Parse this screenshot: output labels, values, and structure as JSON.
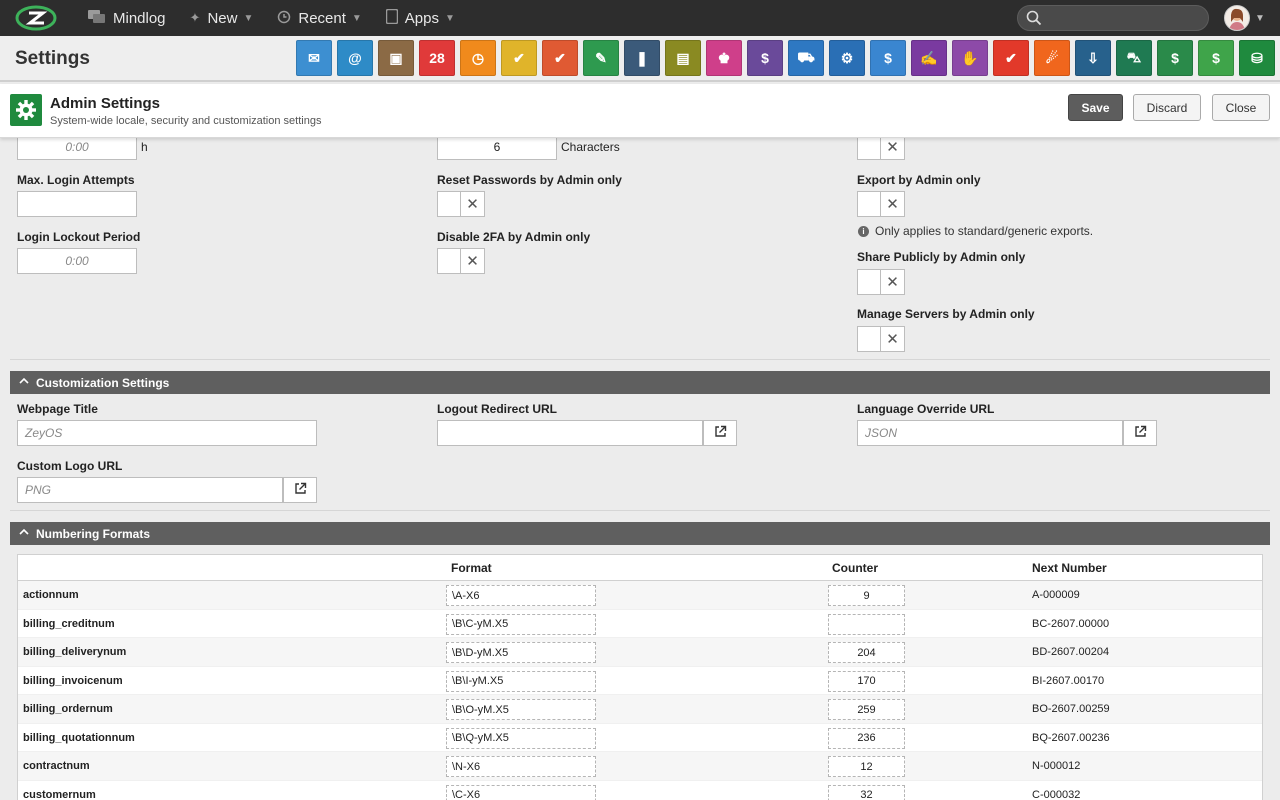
{
  "nav": {
    "mindlog": "Mindlog",
    "new": "New",
    "recent": "Recent",
    "apps": "Apps",
    "search_placeholder": ""
  },
  "settings": {
    "title": "Settings"
  },
  "app_icons": [
    {
      "name": "messages-icon",
      "color": "#3d8fd1",
      "glyph": "✉"
    },
    {
      "name": "email-accounts-icon",
      "color": "#2e8bc7",
      "glyph": "@"
    },
    {
      "name": "contacts-icon",
      "color": "#8b6a45",
      "glyph": "▣"
    },
    {
      "name": "calendar-icon",
      "color": "#e03a3a",
      "glyph": "28"
    },
    {
      "name": "timer-icon",
      "color": "#f08a1c",
      "glyph": "◷"
    },
    {
      "name": "tasks-icon",
      "color": "#e0b42a",
      "glyph": "✔"
    },
    {
      "name": "projects-icon",
      "color": "#e05a33",
      "glyph": "✔"
    },
    {
      "name": "notes-icon",
      "color": "#2e9a4f",
      "glyph": "✎"
    },
    {
      "name": "bookmarks-icon",
      "color": "#3b5a7a",
      "glyph": "❚"
    },
    {
      "name": "documents-icon",
      "color": "#8a8a22",
      "glyph": "▤"
    },
    {
      "name": "campaigns-icon",
      "color": "#cf3f8a",
      "glyph": "♚"
    },
    {
      "name": "finance-icon",
      "color": "#6a4a9a",
      "glyph": "$"
    },
    {
      "name": "delivery-icon",
      "color": "#2e78c2",
      "glyph": "⛟"
    },
    {
      "name": "support-icon",
      "color": "#2a6fb5",
      "glyph": "⚙"
    },
    {
      "name": "money-icon",
      "color": "#3a86d0",
      "glyph": "$"
    },
    {
      "name": "contracts-icon",
      "color": "#7a3aa0",
      "glyph": "✍"
    },
    {
      "name": "deals-icon",
      "color": "#8d4aa8",
      "glyph": "✋"
    },
    {
      "name": "pdf-icon",
      "color": "#e2392a",
      "glyph": "✔"
    },
    {
      "name": "broadcast-icon",
      "color": "#f0661d",
      "glyph": "☄"
    },
    {
      "name": "download-icon",
      "color": "#27618c",
      "glyph": "⇩"
    },
    {
      "name": "cart-icon",
      "color": "#1f7a52",
      "glyph": "⛍"
    },
    {
      "name": "cash-icon",
      "color": "#2a8a4a",
      "glyph": "$"
    },
    {
      "name": "price-tag-icon",
      "color": "#3fa44a",
      "glyph": "$"
    },
    {
      "name": "database-icon",
      "color": "#1f8a3e",
      "glyph": "⛁"
    }
  ],
  "admin": {
    "title": "Admin Settings",
    "subtitle": "System-wide locale, security and customization settings",
    "save": "Save",
    "discard": "Discard",
    "close": "Close"
  },
  "security": {
    "session_timeout_value": "0:00",
    "session_timeout_unit": "h",
    "password_length_value": "6",
    "password_length_unit": "Characters",
    "max_login_label": "Max. Login Attempts",
    "max_login_value": "",
    "lockout_label": "Login Lockout Period",
    "lockout_value": "0:00",
    "reset_pw_label": "Reset Passwords by Admin only",
    "disable_2fa_label": "Disable 2FA by Admin only",
    "export_label": "Export by Admin only",
    "export_note": "Only applies to standard/generic exports.",
    "share_label": "Share Publicly by Admin only",
    "manage_label": "Manage Servers by Admin only"
  },
  "customization": {
    "header": "Customization Settings",
    "webpage_title_label": "Webpage Title",
    "webpage_title_placeholder": "ZeyOS",
    "logout_label": "Logout Redirect URL",
    "logout_placeholder": "",
    "language_label": "Language Override URL",
    "language_placeholder": "JSON",
    "logo_label": "Custom Logo URL",
    "logo_placeholder": "PNG"
  },
  "numbering": {
    "header": "Numbering Formats",
    "col_format": "Format",
    "col_counter": "Counter",
    "col_next": "Next Number",
    "rows": [
      {
        "name": "actionnum",
        "format": "\\A-X6",
        "counter": "9",
        "next": "A-000009"
      },
      {
        "name": "billing_creditnum",
        "format": "\\B\\C-yM.X5",
        "counter": "",
        "next": "BC-2607.00000"
      },
      {
        "name": "billing_deliverynum",
        "format": "\\B\\D-yM.X5",
        "counter": "204",
        "next": "BD-2607.00204"
      },
      {
        "name": "billing_invoicenum",
        "format": "\\B\\I-yM.X5",
        "counter": "170",
        "next": "BI-2607.00170"
      },
      {
        "name": "billing_ordernum",
        "format": "\\B\\O-yM.X5",
        "counter": "259",
        "next": "BO-2607.00259"
      },
      {
        "name": "billing_quotationnum",
        "format": "\\B\\Q-yM.X5",
        "counter": "236",
        "next": "BQ-2607.00236"
      },
      {
        "name": "contractnum",
        "format": "\\N-X6",
        "counter": "12",
        "next": "N-000012"
      },
      {
        "name": "customernum",
        "format": "\\C-X6",
        "counter": "32",
        "next": "C-000032"
      }
    ]
  }
}
